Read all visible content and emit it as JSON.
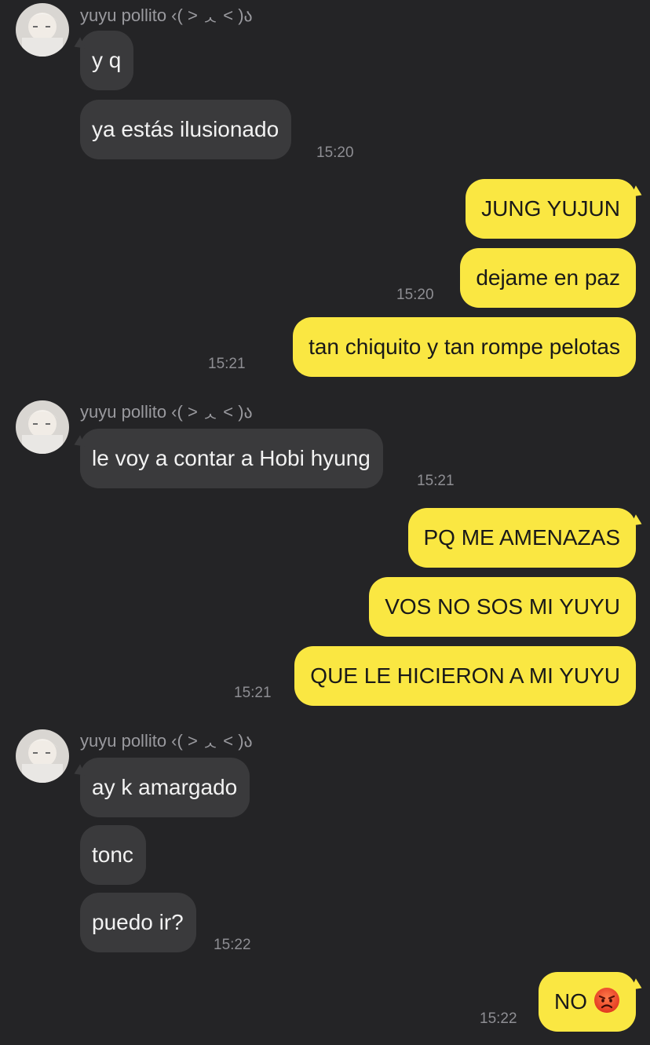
{
  "contact": {
    "name": "yuyu pollito ‹( ˃ ᆺ ˂ )ა"
  },
  "groups": [
    {
      "sender": "them",
      "messages": [
        "y q",
        "ya estás ilusionado"
      ],
      "time": "15:20"
    },
    {
      "sender": "me",
      "messages": [
        "JUNG YUJUN",
        "dejame en paz"
      ],
      "time": "15:20"
    },
    {
      "sender": "me",
      "messages": [
        "tan chiquito y tan rompe pelotas"
      ],
      "time": "15:21"
    },
    {
      "sender": "them",
      "messages": [
        "le voy a contar a Hobi hyung"
      ],
      "time": "15:21"
    },
    {
      "sender": "me",
      "messages": [
        "PQ ME AMENAZAS",
        "VOS NO SOS MI YUYU",
        "QUE LE HICIERON A MI YUYU"
      ],
      "time": "15:21"
    },
    {
      "sender": "them",
      "messages": [
        "ay k amargado",
        "tonc",
        "puedo ir?"
      ],
      "time": "15:22"
    },
    {
      "sender": "me",
      "messages": [
        "NO"
      ],
      "emoji": "angry-face-icon",
      "time": "15:22"
    }
  ],
  "colors": {
    "background": "#242426",
    "incoming_bubble": "#3a3a3c",
    "outgoing_bubble": "#fae742",
    "timestamp": "#8e8e93"
  }
}
